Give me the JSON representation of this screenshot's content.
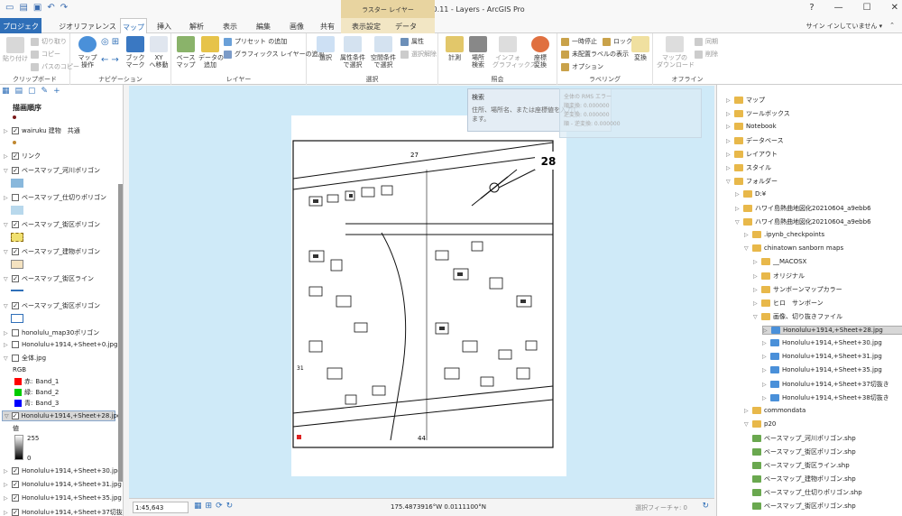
{
  "window": {
    "title": "マウイ-new 2020.11 - Layers - ArcGIS Pro",
    "context_title": "ラスター レイヤー",
    "help": "?",
    "minimize": "—",
    "maximize": "☐",
    "close": "✕"
  },
  "tabs": {
    "file": "プロジェクト",
    "items": [
      "ジオリファレンス",
      "マップ",
      "挿入",
      "解析",
      "表示",
      "編集",
      "画像",
      "共有",
      "表示設定",
      "データ"
    ],
    "signin": "サイン インしていません ▾"
  },
  "ribbon": {
    "clipboard": {
      "paste": "貼り付け",
      "cut": "切り取り",
      "copy": "コピー",
      "copy_path": "パスのコピー",
      "label": "クリップボード"
    },
    "navigation": {
      "explore": "マップ\n操作",
      "bookmarks": "ブック\nマーク",
      "goto": "XY\nへ移動",
      "label": "ナビゲーション"
    },
    "layer": {
      "basemap": "ベース\nマップ",
      "add_data": "データの\n追加",
      "add_preset": "プリセット の追加",
      "add_graphics": "グラフィックス レイヤーの追加",
      "label": "レイヤー"
    },
    "selection": {
      "select": "選択",
      "by_attr": "属性条件\nで選択",
      "by_loc": "空間条件\nで選択",
      "attributes": "属性",
      "clear": "選択解除",
      "label": "選択"
    },
    "inquiry": {
      "measure": "計測",
      "locate": "場所\n検索",
      "infographics": "インフォ\nグラフィックス",
      "convert": "座標\n変換",
      "label": "照会"
    },
    "labeling": {
      "pause": "一時停止",
      "lock": "ロック",
      "unplaced": "未配置ラベルの表示",
      "more": "オプション",
      "convert": "変換",
      "label": "ラベリング"
    },
    "offline": {
      "download": "マップの\nダウンロード",
      "sync": "同期",
      "remove": "削除",
      "label": "オフライン"
    }
  },
  "contents": {
    "heading": "描画順序",
    "layers": [
      {
        "name": "wairuku 建物　共通",
        "checked": true
      },
      {
        "name": "リンク",
        "checked": true
      },
      {
        "name": "ベースマップ_河川ポリゴン",
        "checked": true
      },
      {
        "name": "ベースマップ_仕切りポリゴン",
        "checked": false
      },
      {
        "name": "ベースマップ_街区ポリゴン",
        "checked": true
      },
      {
        "name": "ベースマップ_建物ポリゴン",
        "checked": true
      },
      {
        "name": "ベースマップ_街区ライン",
        "checked": true
      },
      {
        "name": "ベースマップ_街区ポリゴン",
        "checked": true
      },
      {
        "name": "honolulu_map30ポリゴン",
        "checked": false
      },
      {
        "name": "Honolulu+1914,+Sheet+0.jpg",
        "checked": false
      },
      {
        "name": "全体.jpg",
        "checked": false
      }
    ],
    "rgb_label": "RGB",
    "bands": [
      {
        "key": "赤:",
        "value": "Band_1",
        "color": "#ff0000"
      },
      {
        "key": "緑:",
        "value": "Band_2",
        "color": "#00cc00"
      },
      {
        "key": "青:",
        "value": "Band_3",
        "color": "#0000ff"
      }
    ],
    "selected_layer": "Honolulu+1914,+Sheet+28.jpg",
    "value_label": "値",
    "value_high": "255",
    "value_low": "0",
    "more_layers": [
      "Honolulu+1914,+Sheet+30.jpg",
      "Honolulu+1914,+Sheet+31.jpg",
      "Honolulu+1914,+Sheet+35.jpg",
      "Honolulu+1914,+Sheet+37切抜"
    ]
  },
  "map": {
    "sheet_number": "28",
    "street_number_top": "27",
    "street_number_bottom": "44",
    "street_number_left": "31",
    "search_tip_title": "検索",
    "search_tip_body": "住所、場所名、または座標値を入力し\nます。",
    "err_box": "全体の RMS エラー\n順変換: 0.000000\n逆変換: 0.000000\n順 - 逆変換: 0.000000"
  },
  "status": {
    "scale": "1:45,643",
    "coords": "175.4873916°W 0.0111100°N",
    "selected": "選択フィーチャ: 0"
  },
  "catalog": {
    "items": [
      {
        "label": "マップ",
        "indent": 0,
        "type": "item"
      },
      {
        "label": "ツールボックス",
        "indent": 0,
        "type": "item"
      },
      {
        "label": "Notebook",
        "indent": 0,
        "type": "item"
      },
      {
        "label": "データベース",
        "indent": 0,
        "type": "item"
      },
      {
        "label": "レイアウト",
        "indent": 0,
        "type": "item"
      },
      {
        "label": "スタイル",
        "indent": 0,
        "type": "item"
      },
      {
        "label": "フォルダー",
        "indent": 0,
        "type": "open"
      },
      {
        "label": "D:¥",
        "indent": 1,
        "type": "folder"
      },
      {
        "label": "ハワイ島熱曲地図化20210604_a9ebb6",
        "indent": 1,
        "type": "folder"
      },
      {
        "label": "ハワイ島熱曲地図化20210604_a9ebb6",
        "indent": 1,
        "type": "open"
      },
      {
        "label": ".ipynb_checkpoints",
        "indent": 2,
        "type": "folder"
      },
      {
        "label": "chinatown sanborn maps",
        "indent": 2,
        "type": "open"
      },
      {
        "label": "__MACOSX",
        "indent": 3,
        "type": "folder"
      },
      {
        "label": "オリジナル",
        "indent": 3,
        "type": "folder"
      },
      {
        "label": "サンボーンマップカラー",
        "indent": 3,
        "type": "folder"
      },
      {
        "label": "ヒロ　サンボーン",
        "indent": 3,
        "type": "folder"
      },
      {
        "label": "画像、切り抜きファイル",
        "indent": 3,
        "type": "open"
      },
      {
        "label": "Honolulu+1914,+Sheet+28.jpg",
        "indent": 4,
        "type": "raster",
        "selected": true
      },
      {
        "label": "Honolulu+1914,+Sheet+30.jpg",
        "indent": 4,
        "type": "raster"
      },
      {
        "label": "Honolulu+1914,+Sheet+31.jpg",
        "indent": 4,
        "type": "raster"
      },
      {
        "label": "Honolulu+1914,+Sheet+35.jpg",
        "indent": 4,
        "type": "raster"
      },
      {
        "label": "Honolulu+1914,+Sheet+37切抜き",
        "indent": 4,
        "type": "raster"
      },
      {
        "label": "Honolulu+1914,+Sheet+38切抜き",
        "indent": 4,
        "type": "raster"
      },
      {
        "label": "commondata",
        "indent": 2,
        "type": "folder"
      },
      {
        "label": "p20",
        "indent": 2,
        "type": "open"
      },
      {
        "label": "ベースマップ_河川ポリゴン.shp",
        "indent": 2,
        "type": "shp"
      },
      {
        "label": "ベースマップ_街区ポリゴン.shp",
        "indent": 2,
        "type": "shp"
      },
      {
        "label": "ベースマップ_街区ライン.shp",
        "indent": 2,
        "type": "shp"
      },
      {
        "label": "ベースマップ_建物ポリゴン.shp",
        "indent": 2,
        "type": "shp"
      },
      {
        "label": "ベースマップ_仕切りポリゴン.shp",
        "indent": 2,
        "type": "shp"
      },
      {
        "label": "ベースマップ_街区ポリゴン.shp",
        "indent": 2,
        "type": "shp"
      }
    ]
  }
}
